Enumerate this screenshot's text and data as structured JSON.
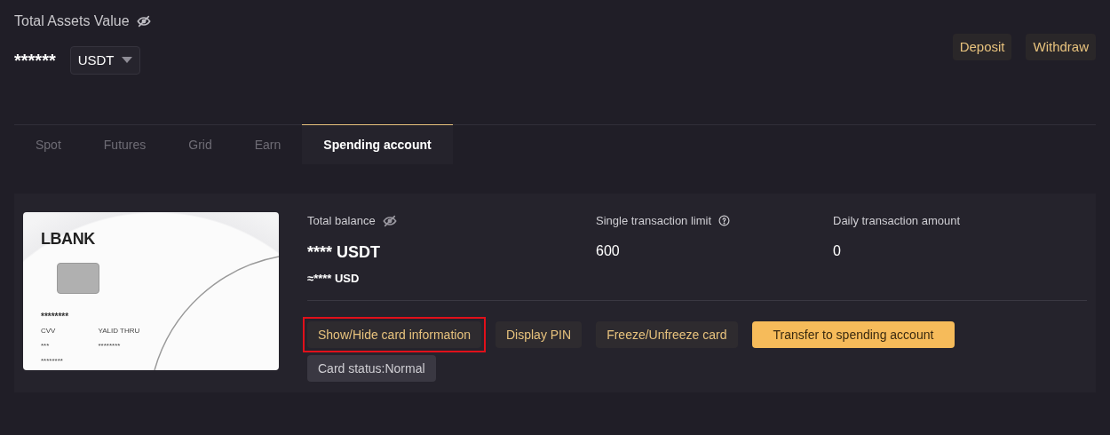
{
  "header": {
    "title": "Total Assets Value",
    "value": "******",
    "currency": "USDT"
  },
  "actions": [
    {
      "label": "Deposit"
    },
    {
      "label": "Withdraw"
    }
  ],
  "tabs": [
    {
      "label": "Spot",
      "selected": false
    },
    {
      "label": "Futures",
      "selected": false
    },
    {
      "label": "Grid",
      "selected": false
    },
    {
      "label": "Earn",
      "selected": false
    },
    {
      "label": "Spending account",
      "selected": true
    }
  ],
  "card": {
    "brand": "LBANK",
    "number": "********",
    "cvv_label": "CVV",
    "cvv": "***",
    "valid_label": "YALID THRU",
    "valid": "********",
    "holder": "********"
  },
  "stats": [
    {
      "label": "Total balance",
      "value": "**** USDT",
      "sub": "≈**** USD"
    },
    {
      "label": "Single transaction limit",
      "value": "600"
    },
    {
      "label": "Daily transaction amount",
      "value": "0"
    }
  ],
  "buttons": [
    {
      "label": "Show/Hide card information",
      "kind": "secondary",
      "highlighted": true
    },
    {
      "label": "Display PIN",
      "kind": "secondary",
      "highlighted": false
    },
    {
      "label": "Freeze/Unfreeze card",
      "kind": "secondary",
      "highlighted": false
    },
    {
      "label": "Transfer to spending account",
      "kind": "primary",
      "highlighted": false
    }
  ],
  "status": "Card status:Normal"
}
